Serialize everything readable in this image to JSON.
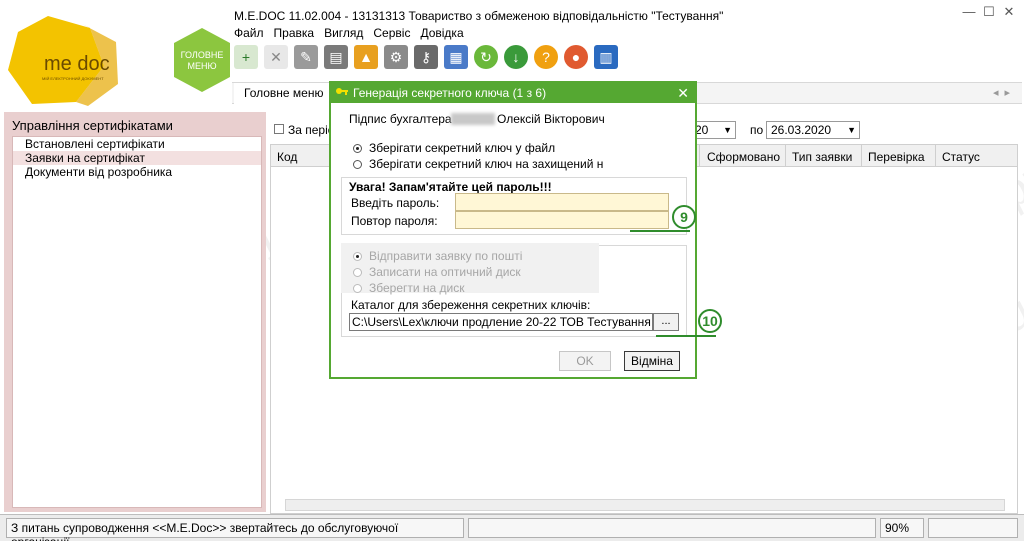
{
  "window": {
    "title": "M.E.DOC 11.02.004 - 13131313 Товариство з обмеженою відповідальністю \"Тестування\""
  },
  "logo": {
    "brand": "me doc",
    "tagline": "МІЙ ЕЛЕКТРОННИЙ ДОКУМЕНТ",
    "home_label": "ГОЛОВНЕ МЕНЮ"
  },
  "menu": [
    "Файл",
    "Правка",
    "Вигляд",
    "Сервіс",
    "Довідка"
  ],
  "toolbar": {
    "icons": [
      "new-document-icon",
      "delete-icon",
      "sign-icon",
      "print-icon",
      "export-icon",
      "settings-icon",
      "calendar-icon",
      "refresh-icon",
      "download-icon",
      "help-icon",
      "chat-icon",
      "building-icon"
    ]
  },
  "tab": {
    "label": "Головне меню"
  },
  "left_panel": {
    "header": "Управління сертифікатами",
    "items": [
      {
        "label": "Встановлені сертифікати"
      },
      {
        "label": "Заявки на сертифікат"
      },
      {
        "label": "Документи від розробника"
      }
    ]
  },
  "filter": {
    "period_label": "За періо",
    "from_value": "20",
    "to_label": "по",
    "to_value": "26.03.2020"
  },
  "grid": {
    "columns": [
      "Код",
      "Сформовано",
      "Тип заявки",
      "Перевірка",
      "Статус"
    ]
  },
  "dialog": {
    "title": "Генерація секретного ключа (1 з 6)",
    "signer_label": "Підпис бухгалтера",
    "signer_name": "Олексій Вікторович",
    "option_file": "Зберігати секретний ключ у файл",
    "option_secure": "Зберігати секретний ключ на захищений н",
    "warning": "Увага! Запам'ятайте цей пароль!!!",
    "password_label": "Введіть пароль:",
    "password_value": "",
    "repeat_label": "Повтор пароля:",
    "repeat_value": "",
    "send_mail": "Відправити заявку  по пошті",
    "write_disk": "Записати на оптичний диск",
    "save_disk": "Зберегти на диск",
    "catalog_label": "Каталог для збереження секретних ключів:",
    "catalog_path": "C:\\Users\\Lex\\ключи продление 20-22 ТОВ Тестування",
    "browse_label": "...",
    "ok_label": "OK",
    "cancel_label": "Відміна"
  },
  "callouts": {
    "first": "9",
    "second": "10"
  },
  "status": {
    "message": "З питань супроводження <<M.E.Doc>> звертайтесь до обслуговуючої організації.",
    "zoom": "90%"
  },
  "watermark": "С-Профит",
  "colors": {
    "accent_green": "#55a832",
    "callout_green": "#2f8c2c",
    "logo_yellow": "#f3c300",
    "panel_pink": "#e9cfcf",
    "password_fill": "#fff7d6"
  }
}
